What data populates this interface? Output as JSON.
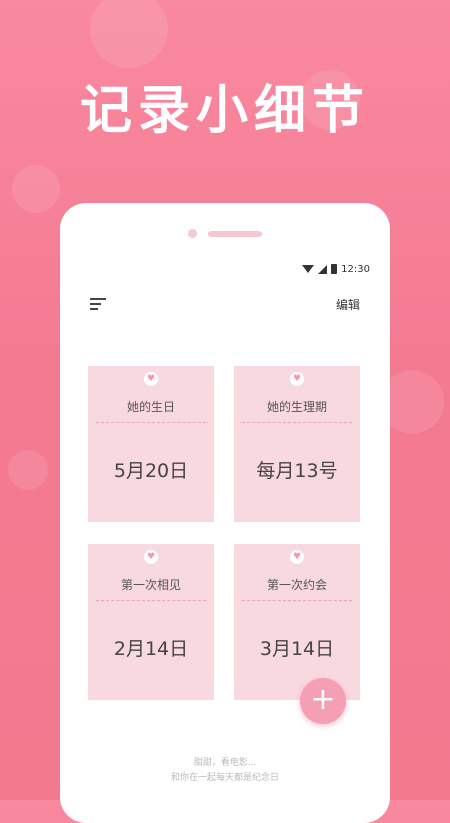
{
  "promo": {
    "headline": "记录小细节"
  },
  "status_bar": {
    "time": "12:30"
  },
  "header": {
    "edit_label": "编辑"
  },
  "cards": [
    {
      "title": "她的生日",
      "value": "5月20日",
      "icon": "heart-badge-icon"
    },
    {
      "title": "她的生理期",
      "value": "每月13号",
      "icon": "heart-badge-icon"
    },
    {
      "title": "第一次相见",
      "value": "2月14日",
      "icon": "heart-badge-icon"
    },
    {
      "title": "第一次约会",
      "value": "3月14日",
      "icon": "heart-badge-icon"
    }
  ],
  "fab": {
    "label": "+"
  },
  "footer": {
    "line1": "甜甜，看电影...",
    "line2": "和你在一起每天都是纪念日"
  },
  "colors": {
    "background": "#f47a92",
    "card": "#f9d9e0",
    "fab": "#f49fb4",
    "accent": "#f49aad"
  }
}
